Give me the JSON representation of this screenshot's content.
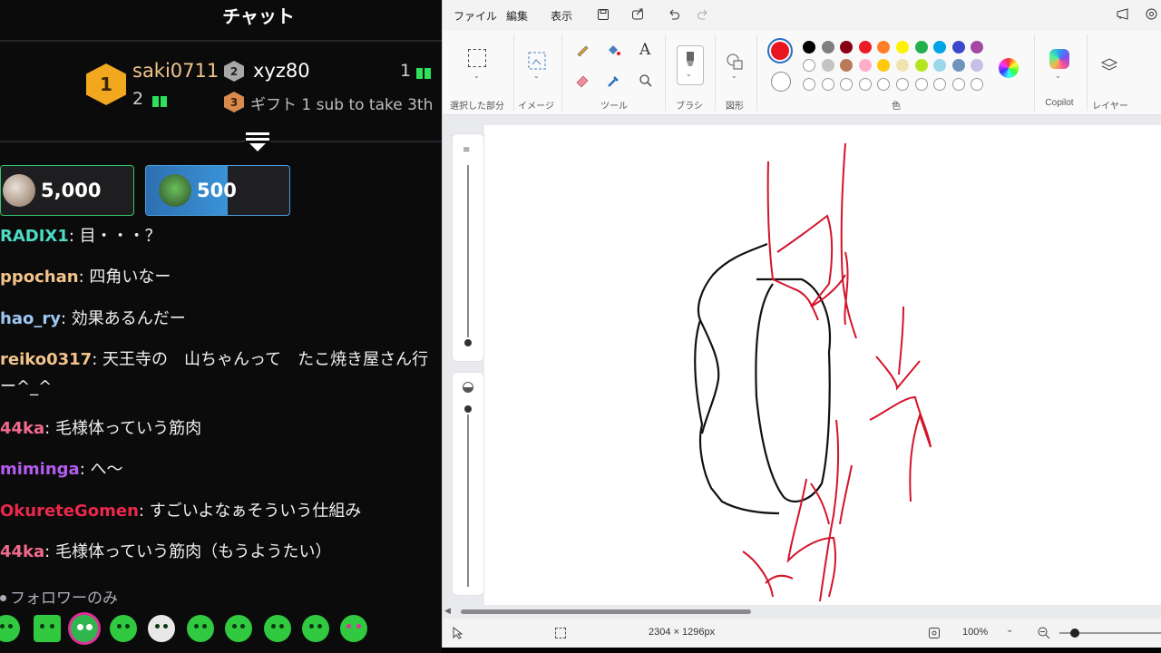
{
  "chat": {
    "title": "チャット",
    "leaderboard": {
      "first": {
        "rank": "1",
        "user": "saki0711",
        "count": "2"
      },
      "second": {
        "rank": "2",
        "user": "xyz80",
        "count": "1"
      },
      "third": {
        "rank": "3",
        "text": "ギフト 1 sub to take 3th"
      }
    },
    "hype_boxes": [
      {
        "value": "5,000"
      },
      {
        "value": "500"
      }
    ],
    "messages": [
      {
        "user": "RADIX1",
        "color": "#4ddbc4",
        "text": "目・・・？"
      },
      {
        "user": "ppochan",
        "color": "#f2c48a",
        "text": "四角いなー"
      },
      {
        "user": "hao_ry",
        "color": "#9ec9f5",
        "text": "効果あるんだー"
      },
      {
        "user": "reiko0317",
        "color": "#f2c48a",
        "text": "天王寺の　山ちゃんって　たこ焼き屋さん行",
        "cont": "ー^_^"
      },
      {
        "user": "44ka",
        "color": "#f06b8a",
        "text": "毛様体っていう筋肉"
      },
      {
        "user": "miminga",
        "color": "#b45cf0",
        "text": "へ〜"
      },
      {
        "user": "OkureteGomen",
        "color": "#e8294a",
        "text": "すごいよなぁそういう仕組み"
      },
      {
        "user": "44ka",
        "color": "#f06b8a",
        "text": "毛様体っていう筋肉（もうようたい）"
      }
    ],
    "follower_only": "フォロワーのみ"
  },
  "paint": {
    "menu": {
      "file": "ファイル",
      "edit": "編集",
      "view": "表示"
    },
    "groups": {
      "selection": "選択した部分",
      "image": "イメージ",
      "tools": "ツール",
      "brush": "ブラシ",
      "shapes": "図形",
      "colors": "色",
      "copilot": "Copilot",
      "layers": "レイヤー"
    },
    "palette_row1": [
      "#000000",
      "#7f7f7f",
      "#880015",
      "#ed1c24",
      "#ff7f27",
      "#fff200",
      "#22b14c",
      "#00a2e8",
      "#3f48cc",
      "#a349a4"
    ],
    "palette_row2": [
      "#ffffff",
      "#c3c3c3",
      "#b97a57",
      "#ffaec9",
      "#ffc90e",
      "#efe4b0",
      "#b5e61d",
      "#99d9ea",
      "#7092be",
      "#c8bfe7"
    ],
    "primary_color": "#e8141f",
    "status": {
      "canvas_size": "2304 × 1296px",
      "zoom": "100%"
    }
  }
}
